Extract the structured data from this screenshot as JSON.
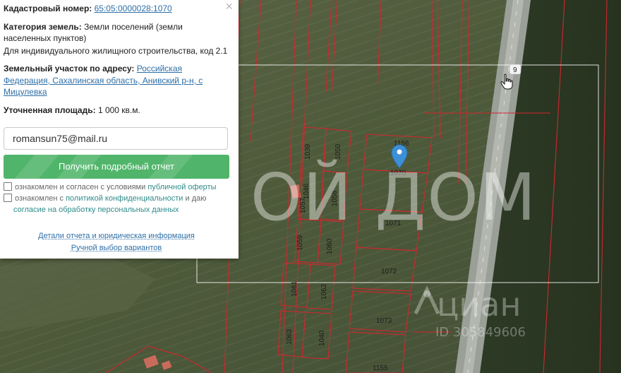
{
  "panel": {
    "cadastral_label": "Кадастровый номер:",
    "cadastral_value": "65:05:0000028:1070",
    "category_label": "Категория земель:",
    "category_value_1": "Земли поселений (земли",
    "category_value_2": "населенных пунктов)",
    "use_line": "Для индивидуального жилищного строительства, код 2.1",
    "address_label": "Земельный участок по адресу:",
    "address_line_1": "Российская",
    "address_line_2": "Федерация, Сахалинская область, Анивский р-н, с",
    "address_line_3": "Мицулевка",
    "area_label": "Уточненная площадь:",
    "area_value": "1 000 кв.м.",
    "email_value": "romansun75@mail.ru",
    "report_button": "Получить подробный отчет",
    "check1_text": "ознакомлен и согласен с условиями",
    "check1_link": "публичной оферты",
    "check2_text_a": "ознакомлен с",
    "check2_link_a": "политикой конфиденциальности",
    "check2_text_b": "и даю",
    "check2_link_b": "согласие на обработку персональных данных",
    "details_link": "Детали отчета и юридическая информация",
    "manual_link": "Ручной выбор вариантов",
    "close_glyph": "×"
  },
  "map": {
    "watermark_text": "ОЙ ДОМ",
    "cian_word": "циан",
    "cian_id": "ID 305849606",
    "road_number": "9",
    "parcel_labels": [
      "1156",
      "1070",
      "1039",
      "1050",
      "1046",
      "1058",
      "1057",
      "1071",
      "1059",
      "1060",
      "1072",
      "1061",
      "1062",
      "1073",
      "1063",
      "1040",
      "1155"
    ],
    "colors": {
      "parcel_line": "#d2262f",
      "selection_box": "#ffffff",
      "marker": "#3d8fd6",
      "button": "#50b56a"
    }
  },
  "icons": {
    "marker": "map-pin-icon",
    "cursor": "hand-cursor-icon",
    "close": "close-icon"
  }
}
